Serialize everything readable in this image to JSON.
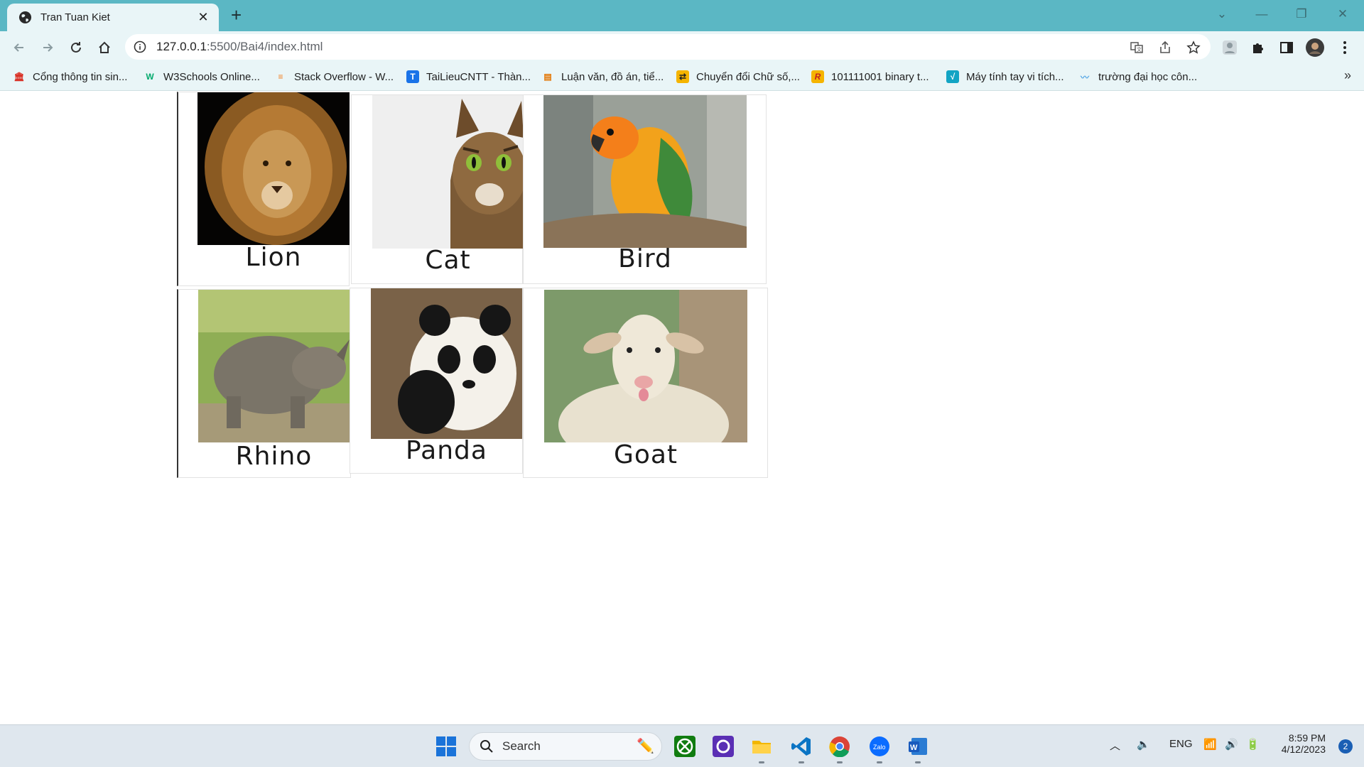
{
  "browser": {
    "tab_title": "Tran Tuan Kiet",
    "address": {
      "host": "127.0.0.1",
      "rest": ":5500/Bai4/index.html"
    },
    "bookmarks": [
      {
        "label": "Cổng thông tin sin...",
        "icon": "university-logo-icon",
        "color": "#d93025"
      },
      {
        "label": "W3Schools Online...",
        "icon": "w3schools-icon",
        "color": "#04aa6d"
      },
      {
        "label": "Stack Overflow - W...",
        "icon": "stackoverflow-icon",
        "color": "#f48024"
      },
      {
        "label": "TaiLieuCNTT - Thàn...",
        "icon": "tailieucntt-icon",
        "color": "#1a73e8"
      },
      {
        "label": "Luận văn, đồ án, tiể...",
        "icon": "document-site-icon",
        "color": "#e37400"
      },
      {
        "label": "Chuyển đổi Chữ số,...",
        "icon": "converter-icon",
        "color": "#f5b400"
      },
      {
        "label": "101111001 binary t...",
        "icon": "rapidtables-icon",
        "color": "#c5221f"
      },
      {
        "label": "Máy tính tay vi tích...",
        "icon": "calculator-site-icon",
        "color": "#12a4c4"
      },
      {
        "label": "trường đại học côn...",
        "icon": "school-wave-icon",
        "color": "#5aa9e6"
      }
    ]
  },
  "gallery": {
    "cards": [
      {
        "caption": "Lion",
        "animal": "lion"
      },
      {
        "caption": "Cat",
        "animal": "cat"
      },
      {
        "caption": "Bird",
        "animal": "bird"
      },
      {
        "caption": "Rhino",
        "animal": "rhino"
      },
      {
        "caption": "Panda",
        "animal": "panda"
      },
      {
        "caption": "Goat",
        "animal": "goat"
      }
    ]
  },
  "taskbar": {
    "search_placeholder": "Search",
    "tray": {
      "language": "ENG",
      "time": "8:59 PM",
      "date": "4/12/2023",
      "notifications": "2"
    }
  }
}
